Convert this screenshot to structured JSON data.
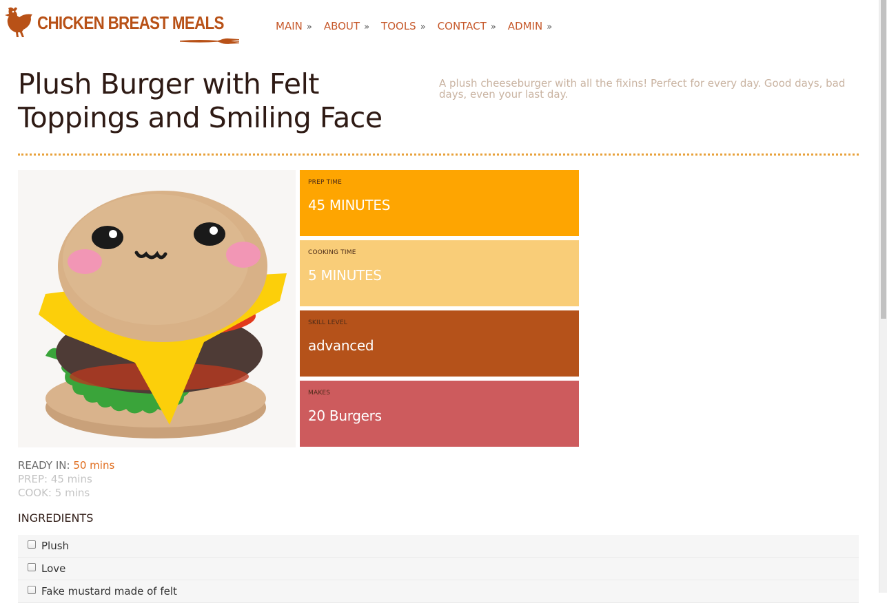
{
  "brand": {
    "name": "CHICKEN BREAST MEALS",
    "color": "#b85117"
  },
  "nav": {
    "items": [
      {
        "label": "MAIN",
        "sep": "»"
      },
      {
        "label": "ABOUT",
        "sep": "»"
      },
      {
        "label": "TOOLS",
        "sep": "»"
      },
      {
        "label": "CONTACT",
        "sep": "»"
      },
      {
        "label": "ADMIN",
        "sep": "»"
      }
    ],
    "color": "#c6582a"
  },
  "recipe": {
    "title": "Plush Burger with Felt Toppings and Smiling Face",
    "description": "A plush cheeseburger with all the fixins! Perfect for every day. Good days, bad days, even your last day.",
    "image_icon": "plush-burger-photo"
  },
  "stats": [
    {
      "label": "PREP TIME",
      "value": "45 MINUTES",
      "color": "#fea501"
    },
    {
      "label": "COOKING TIME",
      "value": "5 MINUTES",
      "color": "#f9cd78"
    },
    {
      "label": "SKILL LEVEL",
      "value": "advanced",
      "color": "#b5521a"
    },
    {
      "label": "MAKES",
      "value": "20 Burgers",
      "color": "#cd5b5d"
    }
  ],
  "times": {
    "ready_label": "READY IN:",
    "ready_value": "50 mins",
    "prep_label": "PREP:",
    "prep_value": "45 mins",
    "cook_label": "COOK:",
    "cook_value": "5 mins"
  },
  "ingredients": {
    "heading": "INGREDIENTS",
    "items": [
      {
        "name": "Plush",
        "checked": false
      },
      {
        "name": "Love",
        "checked": false
      },
      {
        "name": "Fake mustard made of felt",
        "checked": false
      }
    ]
  }
}
